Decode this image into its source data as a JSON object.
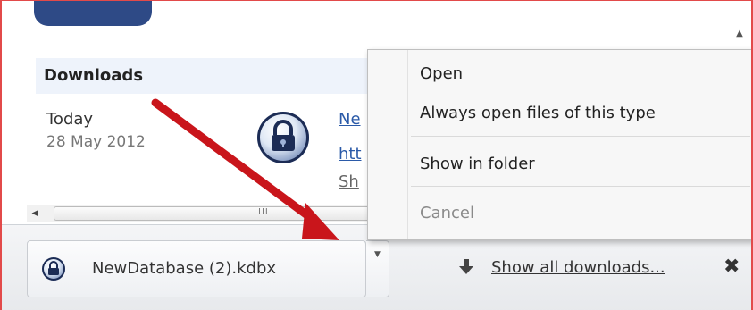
{
  "downloads_page": {
    "title": "Downloads",
    "date_group": {
      "day": "Today",
      "date": "28 May 2012"
    },
    "item": {
      "link_name": "Ne",
      "link_url": "htt",
      "link_show": "Sh"
    },
    "hscroll_grip": "III"
  },
  "context_menu": {
    "items": [
      {
        "label": "Open",
        "enabled": true
      },
      {
        "label": "Always open files of this type",
        "enabled": true
      },
      {
        "label": "Show in folder",
        "enabled": true
      },
      {
        "label": "Cancel",
        "enabled": false
      }
    ]
  },
  "download_shelf": {
    "filename": "NewDatabase (2).kdbx",
    "show_all_label": "Show all downloads...",
    "close_glyph": "✖"
  },
  "colors": {
    "annotation_arrow": "#c9151b",
    "link": "#2b5aa8",
    "header_bg": "#eef3fb",
    "blue_button": "#2e4a86"
  },
  "icons": [
    "keepass-lock-icon",
    "scroll-up-icon",
    "scroll-left-icon",
    "dropdown-arrow-icon",
    "download-arrow-icon",
    "close-icon"
  ]
}
